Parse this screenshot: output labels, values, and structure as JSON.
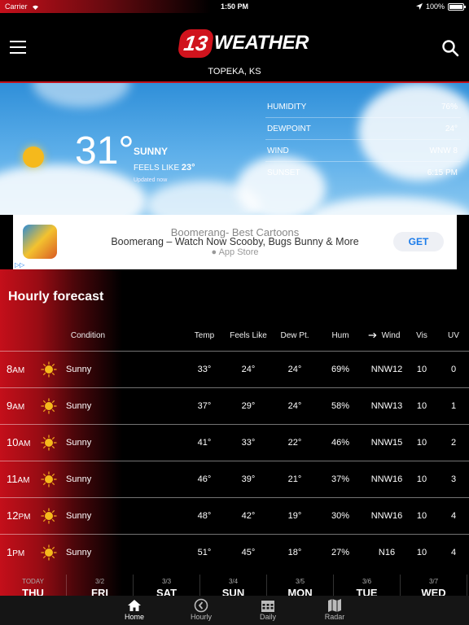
{
  "status": {
    "carrier": "Carrier",
    "time": "1:50 PM",
    "battery": "100%"
  },
  "header": {
    "logo_number": "13",
    "logo_text": "WEATHER",
    "location": "TOPEKA, KS"
  },
  "current": {
    "temp": "31°",
    "condition": "SUNNY",
    "feels_label": "FEELS LIKE",
    "feels_value": "23°",
    "updated": "Updated now",
    "details": [
      {
        "label": "HUMIDITY",
        "value": "76%"
      },
      {
        "label": "DEWPOINT",
        "value": "24°"
      },
      {
        "label": "WIND",
        "value": "WNW 8"
      },
      {
        "label": "SUNSET",
        "value": "6:15 PM"
      }
    ]
  },
  "ad": {
    "title_back": "Boomerang- Best Cartoons",
    "title": "Boomerang – Watch Now Scooby, Bugs Bunny & More",
    "store": "App Store",
    "button": "GET",
    "choices": "▷▷"
  },
  "hourly": {
    "title": "Hourly forecast",
    "columns": {
      "condition": "Condition",
      "temp": "Temp",
      "feels": "Feels Like",
      "dew": "Dew Pt.",
      "hum": "Hum",
      "wind": "Wind",
      "vis": "Vis",
      "uv": "UV"
    },
    "rows": [
      {
        "hour": "8",
        "ampm": "AM",
        "condition": "Sunny",
        "temp": "33°",
        "feels": "24°",
        "dew": "24°",
        "hum": "69%",
        "wind": "NNW12",
        "vis": "10",
        "uv": "0"
      },
      {
        "hour": "9",
        "ampm": "AM",
        "condition": "Sunny",
        "temp": "37°",
        "feels": "29°",
        "dew": "24°",
        "hum": "58%",
        "wind": "NNW13",
        "vis": "10",
        "uv": "1"
      },
      {
        "hour": "10",
        "ampm": "AM",
        "condition": "Sunny",
        "temp": "41°",
        "feels": "33°",
        "dew": "22°",
        "hum": "46%",
        "wind": "NNW15",
        "vis": "10",
        "uv": "2"
      },
      {
        "hour": "11",
        "ampm": "AM",
        "condition": "Sunny",
        "temp": "46°",
        "feels": "39°",
        "dew": "21°",
        "hum": "37%",
        "wind": "NNW16",
        "vis": "10",
        "uv": "3"
      },
      {
        "hour": "12",
        "ampm": "PM",
        "condition": "Sunny",
        "temp": "48°",
        "feels": "42°",
        "dew": "19°",
        "hum": "30%",
        "wind": "NNW16",
        "vis": "10",
        "uv": "4"
      },
      {
        "hour": "1",
        "ampm": "PM",
        "condition": "Sunny",
        "temp": "51°",
        "feels": "45°",
        "dew": "18°",
        "hum": "27%",
        "wind": "N16",
        "vis": "10",
        "uv": "4"
      }
    ]
  },
  "days": [
    {
      "date": "TODAY",
      "name": "THU"
    },
    {
      "date": "3/2",
      "name": "FRI"
    },
    {
      "date": "3/3",
      "name": "SAT"
    },
    {
      "date": "3/4",
      "name": "SUN"
    },
    {
      "date": "3/5",
      "name": "MON"
    },
    {
      "date": "3/6",
      "name": "TUE"
    },
    {
      "date": "3/7",
      "name": "WED"
    }
  ],
  "tabs": [
    {
      "label": "Home",
      "icon": "home-icon"
    },
    {
      "label": "Hourly",
      "icon": "clock-icon"
    },
    {
      "label": "Daily",
      "icon": "calendar-icon"
    },
    {
      "label": "Radar",
      "icon": "map-icon"
    }
  ],
  "colors": {
    "brand_red": "#c0121c",
    "sun": "#f5b91c",
    "accent_blue": "#1a7bea"
  }
}
